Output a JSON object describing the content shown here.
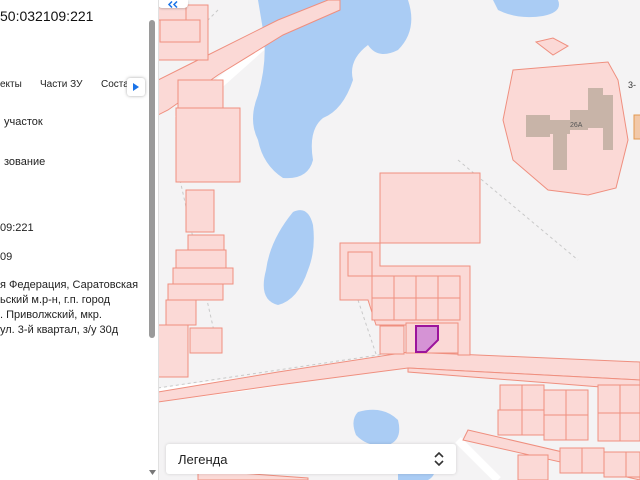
{
  "panel": {
    "title": "50:032109:221",
    "tabs": [
      {
        "label": "екты"
      },
      {
        "label": "Части ЗУ"
      },
      {
        "label": "Соста"
      }
    ],
    "fields": [
      {
        "value": "участок"
      },
      {
        "value": "зование"
      },
      {
        "value": "09:221"
      },
      {
        "value": "09"
      }
    ],
    "address": [
      "я Федерация, Саратовская",
      "ьский м.р-н, г.п. город",
      ". Приволжский, мкр.",
      "ул. 3-й квартал, з/у 30д"
    ]
  },
  "map": {
    "labels": [
      {
        "text": "26А"
      },
      {
        "text": "3-"
      }
    ],
    "colors": {
      "background": "#f4f3f4",
      "water": "#aaccf4",
      "parcel_fill": "#fbd9d6",
      "parcel_stroke": "#ef8f7f",
      "selected_fill": "#d593d5",
      "selected_stroke": "#9c149c",
      "building": "#c8b4a8",
      "road": "#ffffff"
    }
  },
  "legend": {
    "label": "Легенда",
    "icon": "expand-collapse-chevron-icon"
  },
  "icons": {
    "collapse": "double-chevron-left-icon",
    "tabs_next": "chevron-right-icon",
    "scroll_down": "scroll-down-arrow-icon"
  }
}
